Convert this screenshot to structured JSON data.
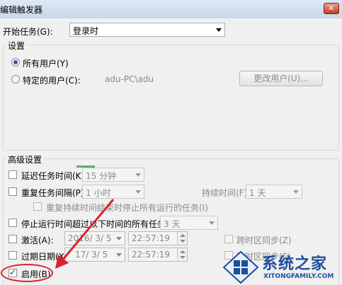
{
  "window": {
    "title": "编辑触发器"
  },
  "begin_task": {
    "label": "开始任务(G):",
    "value": "登录时"
  },
  "settings": {
    "group_label": "设置",
    "all_users": "所有用户(Y)",
    "specific_user": "特定的用户(C):",
    "user_name": "adu-PC\\adu",
    "change_user_button": "更改用户(U)..."
  },
  "advanced": {
    "group_label": "高级设置",
    "delay": {
      "label": "延迟任务时间(K):",
      "value": "15 分钟"
    },
    "repeat": {
      "label": "重复任务间隔(P):",
      "value": "1 小时",
      "duration_label": "持续时间(F):",
      "duration_value": "1 天"
    },
    "stop_all": {
      "label": "重复持续时间结束时停止所有运行的任务(I)"
    },
    "stop_if_longer": {
      "label": "停止运行时间超过以下时间的所有任务(L):",
      "value": "3 天"
    },
    "activate": {
      "label": "激活(A):",
      "date": "2016/ 3/ 5",
      "time": "22:57:19",
      "sync_label": "跨时区同步(Z)"
    },
    "expire": {
      "label": "过期日期(X):",
      "date": "17/ 3/ 5",
      "time": "22:57:19",
      "sync_label": "跨时区同步(E)"
    },
    "enabled": {
      "label": "启用(B)"
    }
  },
  "watermark": {
    "title": "系统之家",
    "subtitle": "XITONGFAMILY.COM"
  },
  "colors": {
    "annotation": "#d9232d",
    "brand": "#1e4f9d"
  }
}
